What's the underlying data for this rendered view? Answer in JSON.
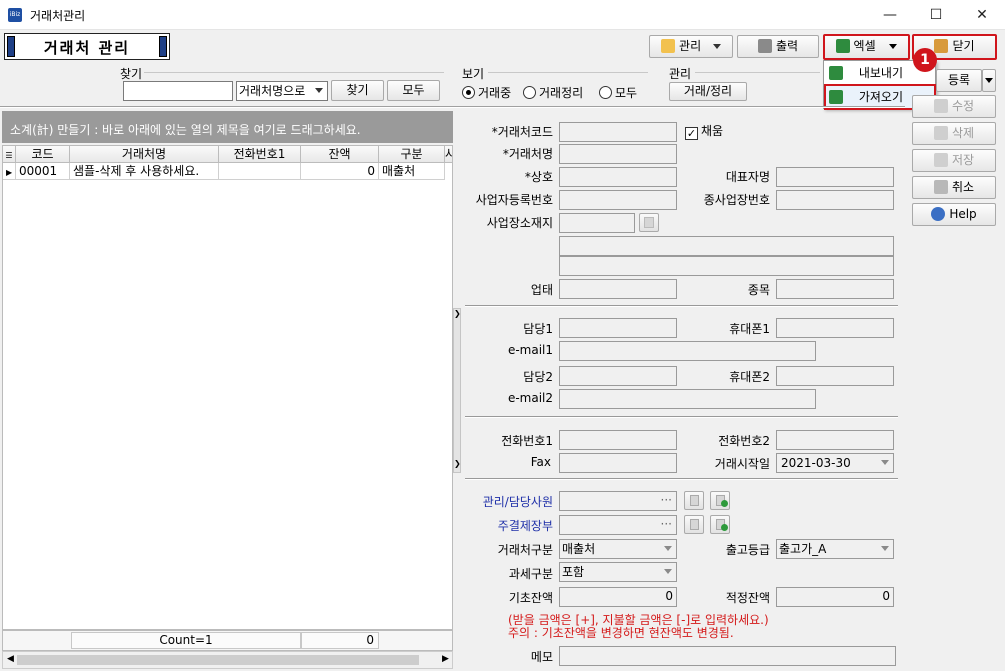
{
  "window": {
    "title": "거래처관리",
    "icon_text": "iBiz"
  },
  "header": {
    "page_title": "거래처 관리"
  },
  "toolbar": {
    "manage": "관리",
    "print": "출력",
    "excel": "엑셀",
    "close": "닫기"
  },
  "excel_menu": {
    "export": "내보내기",
    "import": "가져오기",
    "callout_number": "1"
  },
  "side_buttons": {
    "register": "등록",
    "edit": "수정",
    "delete": "삭제",
    "save": "저장",
    "cancel": "취소",
    "help": "Help"
  },
  "search": {
    "group_label": "찾기",
    "value": "",
    "mode": "거래처명으로",
    "find": "찾기",
    "all": "모두"
  },
  "view": {
    "group_label": "보기",
    "options": [
      "거래중",
      "거래정리",
      "모두"
    ],
    "selected": "거래중"
  },
  "manage_group": {
    "label": "관리",
    "button": "거래/정리"
  },
  "grid": {
    "hint": "소계(計) 만들기 : 바로 아래에 있는 열의 제목을 여기로 드래그하세요.",
    "columns": [
      "코드",
      "거래처명",
      "전화번호1",
      "잔액",
      "구분",
      "사"
    ],
    "rows": [
      {
        "code": "00001",
        "name": "샘플-삭제 후 사용하세요.",
        "phone": "",
        "balance": "0",
        "type": "매출처"
      }
    ],
    "footer_count": "Count=1",
    "footer_sum": "0"
  },
  "form": {
    "code_label": "*거래처코드",
    "use_label": "채움",
    "use_checked": true,
    "name_label": "*거래처명",
    "trade_name_label": "*상호",
    "rep_label": "대표자명",
    "biz_no_label": "사업자등록번호",
    "sub_biz_label": "종사업장번호",
    "address_label": "사업장소재지",
    "biz_type_label": "업태",
    "biz_item_label": "종목",
    "manager1_label": "담당1",
    "mobile1_label": "휴대폰1",
    "email1_label": "e-mail1",
    "manager2_label": "담당2",
    "mobile2_label": "휴대폰2",
    "email2_label": "e-mail2",
    "phone1_label": "전화번호1",
    "phone2_label": "전화번호2",
    "fax_label": "Fax",
    "trade_start_label": "거래시작일",
    "trade_start_value": "2021-03-30",
    "staff_label": "관리/담당사원",
    "ledger_label": "주결제장부",
    "partner_type_label": "거래처구분",
    "partner_type_value": "매출처",
    "grade_label": "출고등급",
    "grade_value": "출고가_A",
    "tax_label": "과세구분",
    "tax_value": "포함",
    "opening_label": "기초잔액",
    "opening_value": "0",
    "proper_label": "적정잔액",
    "proper_value": "0",
    "warn1": "(받을 금액은 [+], 지불할 금액은 [-]로 입력하세요.)",
    "warn2": "주의 : 기초잔액을 변경하면 현잔액도 변경됨.",
    "memo_label": "메모"
  }
}
